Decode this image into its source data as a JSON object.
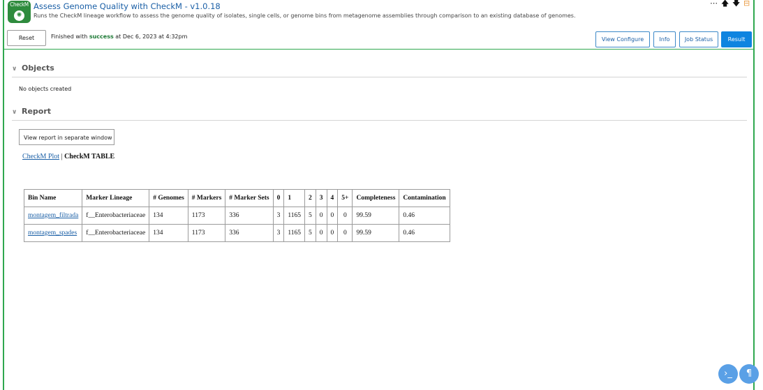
{
  "header": {
    "icon_text": "CheckM",
    "title": "Assess Genome Quality with CheckM - v1.0.18",
    "subtitle": "Runs the CheckM lineage workflow to assess the genome quality of isolates, single cells, or genome bins from metagenome assemblies through comparison to an existing database of genomes.",
    "controls": [
      "more-icon",
      "arrow-up-icon",
      "arrow-down-icon",
      "collapse-icon"
    ]
  },
  "toolbar": {
    "reset_label": "Reset",
    "status_prefix": "Finished with",
    "status_word": "success",
    "status_suffix": "at Dec 6, 2023 at 4:32pm",
    "tabs": [
      {
        "label": "View Configure"
      },
      {
        "label": "Info"
      },
      {
        "label": "Job Status"
      },
      {
        "label": "Result"
      }
    ]
  },
  "objects": {
    "heading": "Objects",
    "empty_text": "No objects created"
  },
  "report": {
    "heading": "Report",
    "separate_window_label": "View report in separate window",
    "plot_link": "CheckM Plot",
    "separator": "|",
    "table_link": "CheckM TABLE"
  },
  "table": {
    "columns": [
      "Bin Name",
      "Marker Lineage",
      "# Genomes",
      "# Markers",
      "# Marker Sets",
      "0",
      "1",
      "2",
      "3",
      "4",
      "5+",
      "Completeness",
      "Contamination"
    ],
    "rows": [
      [
        "montagem_filtrada",
        "f__Enterobacteriaceae",
        "134",
        "1173",
        "336",
        "3",
        "1165",
        "5",
        "0",
        "0",
        "0",
        "99.59",
        "0.46"
      ],
      [
        "montagem_spades",
        "f__Enterobacteriaceae",
        "134",
        "1173",
        "336",
        "3",
        "1165",
        "5",
        "0",
        "0",
        "0",
        "99.59",
        "0.46"
      ]
    ]
  },
  "colors": {
    "accent_green": "#2fa84f",
    "link_blue": "#1a5fa6",
    "active_tab": "#0e84e0",
    "fab": "#5aa0e6"
  },
  "floating_buttons": [
    "terminal-icon",
    "paragraph-icon"
  ]
}
